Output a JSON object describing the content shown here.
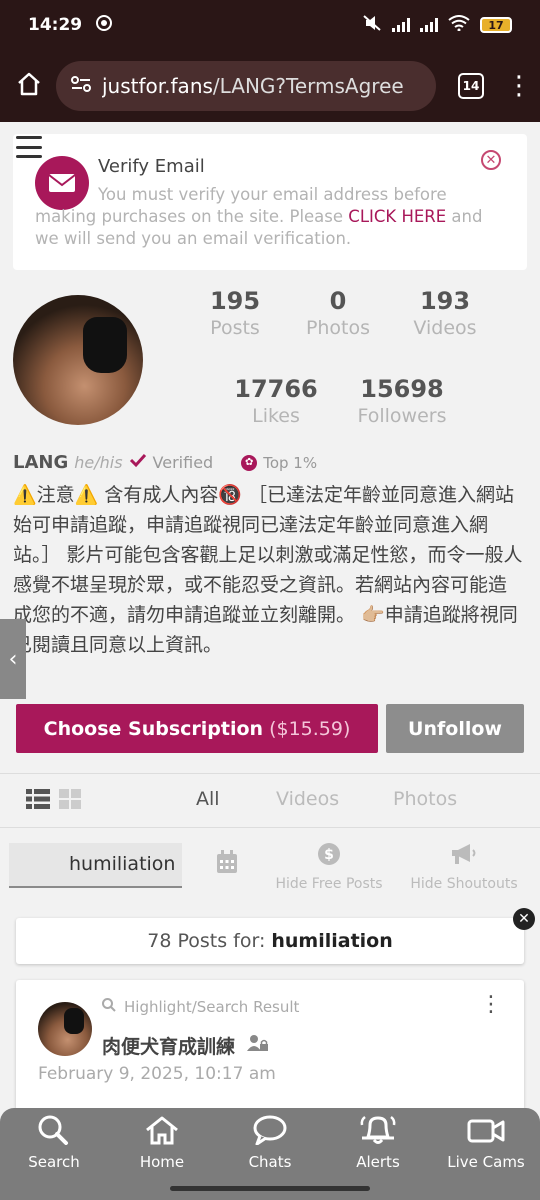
{
  "status_bar": {
    "time": "14:29",
    "battery": "17"
  },
  "browser": {
    "url_host": "justfor.fans",
    "url_path": "/LANG?TermsAgree",
    "tab_count": "14"
  },
  "verify_email": {
    "title": "Verify Email",
    "message_prefix": "You must verify your email address before making purchases on the site. Please ",
    "link_text": "CLICK HERE",
    "message_suffix": " and we will send you an email verification."
  },
  "profile": {
    "stats": [
      {
        "num": "195",
        "label": "Posts"
      },
      {
        "num": "0",
        "label": "Photos"
      },
      {
        "num": "193",
        "label": "Videos"
      },
      {
        "num": "17766",
        "label": "Likes"
      },
      {
        "num": "15698",
        "label": "Followers"
      }
    ],
    "name": "LANG",
    "pronouns": "he/his",
    "verified": "Verified",
    "top": "Top 1%",
    "bio": "⚠️注意⚠️ 含有成人內容🔞 ［已達法定年齡並同意進入網站始可申請追蹤，申請追蹤視同已達法定年齡並同意進入網站。］ 影片可能包含客觀上足以刺激或滿足性慾，而令一般人感覺不堪呈現於眾，或不能忍受之資訊。若網站內容可能造成您的不適，請勿申請追蹤並立刻離開。 👉🏼申請追蹤將視同已閱讀且同意以上資訊。"
  },
  "actions": {
    "subscribe_label": "Choose Subscription",
    "subscribe_price": "($15.59)",
    "unfollow_label": "Unfollow"
  },
  "tabs": [
    "All",
    "Videos",
    "Photos"
  ],
  "filters": {
    "search_value": "humiliation",
    "hide_free": "Hide Free Posts",
    "hide_shoutouts": "Hide Shoutouts"
  },
  "results": {
    "prefix": "78 Posts for:",
    "term": "humiliation"
  },
  "post": {
    "highlight": "Highlight/Search Result",
    "title": "肉便犬育成訓練",
    "date": "February 9, 2025, 10:17 am"
  },
  "bottom_nav": [
    "Search",
    "Home",
    "Chats",
    "Alerts",
    "Live Cams"
  ],
  "colors": {
    "brand": "#a8185a",
    "unfollow": "#8d8d8d",
    "nav": "#7c7c7c",
    "chrome": "#2a1616"
  }
}
